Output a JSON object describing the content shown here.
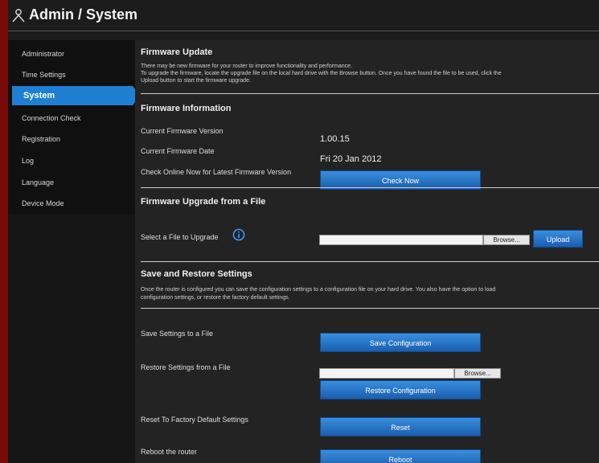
{
  "header": {
    "title": "Admin / System"
  },
  "sidebar": {
    "items": [
      "Administrator",
      "Time Settings",
      "System",
      "Connection Check",
      "Registration",
      "Log",
      "Language",
      "Device Mode"
    ],
    "active": "System"
  },
  "firmware_update": {
    "title": "Firmware Update",
    "desc1": "There may be new firmware for your router to improve functionality and performance.",
    "desc2": "To upgrade the firmware, locate the upgrade file on the local hard drive with the Browse button. Once you have found the file to be used, click the",
    "desc3": "Upload button to start the firmware upgrade."
  },
  "firmware_info": {
    "title": "Firmware Information",
    "version_label": "Current Firmware Version",
    "version_value": "1.00.15",
    "date_label": "Current Firmware Date",
    "date_value": "Fri 20 Jan 2012",
    "check_label": "Check Online Now for Latest Firmware Version",
    "check_button": "Check Now"
  },
  "firmware_upgrade": {
    "title": "Firmware Upgrade from a File",
    "select_label": "Select a File to Upgrade",
    "browse": "Browse...",
    "upload": "Upload"
  },
  "save_restore": {
    "title": "Save and Restore Settings",
    "desc1": "Once the router is configured you can save the configuration settings to a configuration file on your hard drive. You also have the option to load",
    "desc2": "configuration settings, or restore the factory default settings.",
    "save_label": "Save Settings to a File",
    "save_button": "Save Configuration",
    "restore_label": "Restore Settings from a File",
    "restore_browse": "Browse...",
    "restore_button": "Restore Configuration",
    "reset_label": "Reset To Factory Default Settings",
    "reset_button": "Reset",
    "reboot_label": "Reboot the router",
    "reboot_button": "Reboot"
  },
  "colors": {
    "accent": "#1f7fd2",
    "background": "#232323",
    "border_red": "#7a0a0a"
  }
}
